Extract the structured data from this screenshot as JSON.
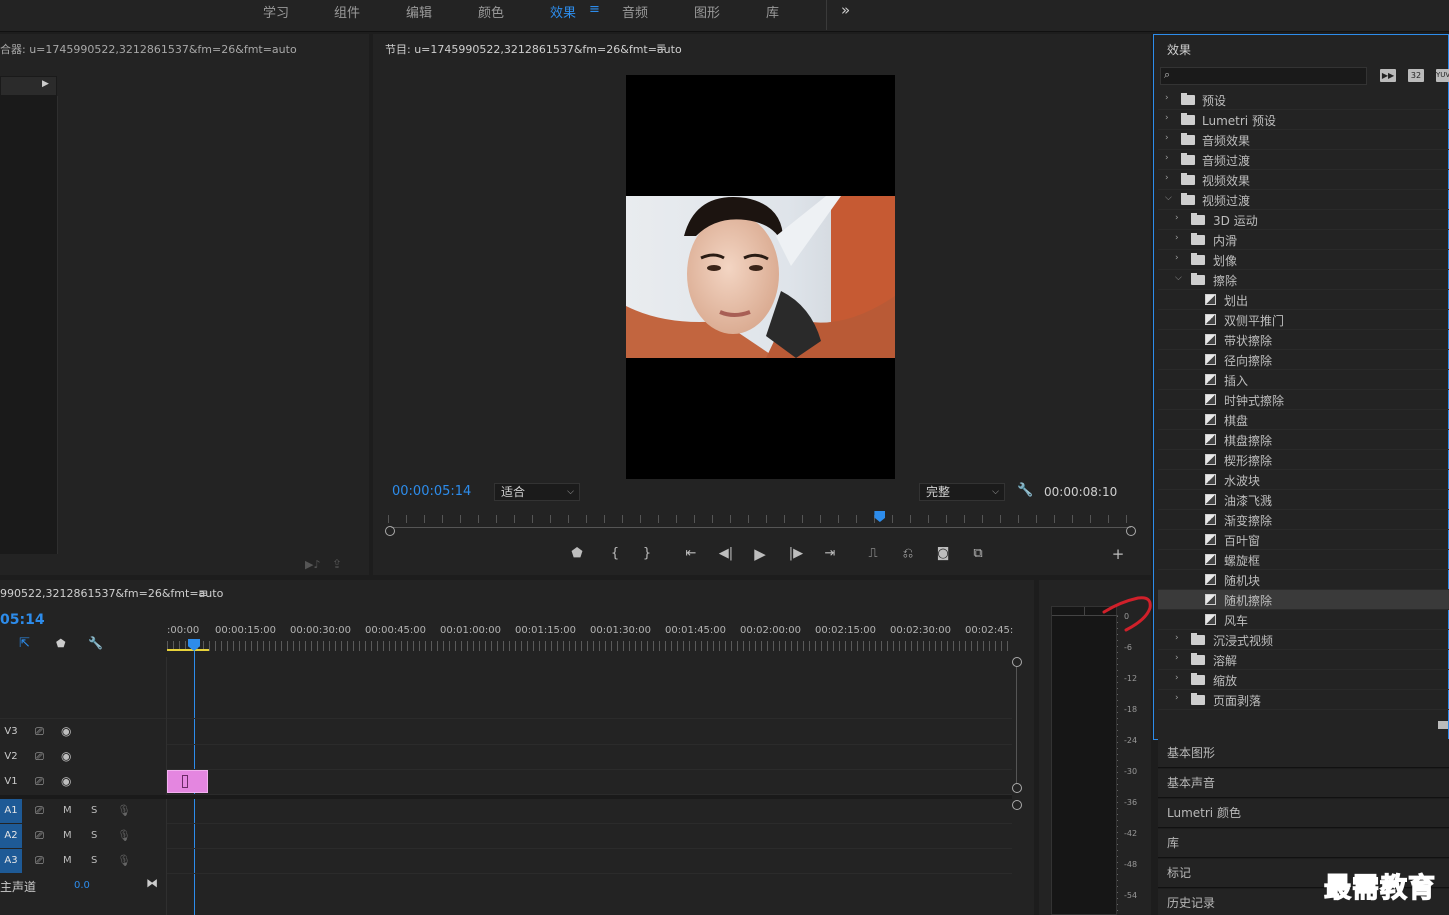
{
  "workspace_tabs": [
    {
      "label": "学习",
      "active": false
    },
    {
      "label": "组件",
      "active": false
    },
    {
      "label": "编辑",
      "active": false
    },
    {
      "label": "颜色",
      "active": false
    },
    {
      "label": "效果",
      "active": true
    },
    {
      "label": "音频",
      "active": false
    },
    {
      "label": "图形",
      "active": false
    },
    {
      "label": "库",
      "active": false
    }
  ],
  "workspace_menu_icon": "≡",
  "overflow_icon": "»",
  "source_panel": {
    "title": "合器: u=1745990522,3212861537&fm=26&fmt=auto"
  },
  "program_monitor": {
    "title": "节目: u=1745990522,3212861537&fm=26&fmt=auto",
    "current_timecode": "00:00:05:14",
    "zoom_select": "适合",
    "quality_select": "完整",
    "duration": "00:00:08:10",
    "playhead_fraction": 0.66
  },
  "timeline": {
    "title": "990522,3212861537&fm=26&fmt=auto",
    "timecode_partial": "05:14",
    "ruler_labels": [
      ":00:00",
      "00:00:15:00",
      "00:00:30:00",
      "00:00:45:00",
      "00:01:00:00",
      "00:01:15:00",
      "00:01:30:00",
      "00:01:45:00",
      "00:02:00:00",
      "00:02:15:00",
      "00:02:30:00",
      "00:02:45:"
    ],
    "video_tracks": [
      "V3",
      "V2",
      "V1"
    ],
    "audio_tracks": [
      "A1",
      "A2",
      "A3"
    ],
    "audio_m": "M",
    "audio_s": "S",
    "master_label": "主声道",
    "master_value": "0.0"
  },
  "audio_meter": {
    "labels": [
      "0",
      "-6",
      "-12",
      "-18",
      "-24",
      "-30",
      "-36",
      "-42",
      "-48",
      "-54"
    ]
  },
  "effects_panel": {
    "title": "效果",
    "search_placeholder": "",
    "badges": [
      "32",
      "YUV"
    ],
    "tree": [
      {
        "label": "预设",
        "level": 0,
        "kind": "preset-folder",
        "expanded": false
      },
      {
        "label": "Lumetri 预设",
        "level": 0,
        "kind": "preset-folder",
        "expanded": false
      },
      {
        "label": "音频效果",
        "level": 0,
        "kind": "folder",
        "expanded": false
      },
      {
        "label": "音频过渡",
        "level": 0,
        "kind": "folder",
        "expanded": false
      },
      {
        "label": "视频效果",
        "level": 0,
        "kind": "folder",
        "expanded": false
      },
      {
        "label": "视频过渡",
        "level": 0,
        "kind": "folder",
        "expanded": true
      },
      {
        "label": "3D 运动",
        "level": 1,
        "kind": "folder",
        "expanded": false
      },
      {
        "label": "内滑",
        "level": 1,
        "kind": "folder",
        "expanded": false
      },
      {
        "label": "划像",
        "level": 1,
        "kind": "folder",
        "expanded": false
      },
      {
        "label": "擦除",
        "level": 1,
        "kind": "folder",
        "expanded": true
      },
      {
        "label": "划出",
        "level": 2,
        "kind": "effect"
      },
      {
        "label": "双侧平推门",
        "level": 2,
        "kind": "effect"
      },
      {
        "label": "带状擦除",
        "level": 2,
        "kind": "effect"
      },
      {
        "label": "径向擦除",
        "level": 2,
        "kind": "effect"
      },
      {
        "label": "插入",
        "level": 2,
        "kind": "effect"
      },
      {
        "label": "时钟式擦除",
        "level": 2,
        "kind": "effect"
      },
      {
        "label": "棋盘",
        "level": 2,
        "kind": "effect"
      },
      {
        "label": "棋盘擦除",
        "level": 2,
        "kind": "effect"
      },
      {
        "label": "楔形擦除",
        "level": 2,
        "kind": "effect"
      },
      {
        "label": "水波块",
        "level": 2,
        "kind": "effect"
      },
      {
        "label": "油漆飞溅",
        "level": 2,
        "kind": "effect"
      },
      {
        "label": "渐变擦除",
        "level": 2,
        "kind": "effect"
      },
      {
        "label": "百叶窗",
        "level": 2,
        "kind": "effect"
      },
      {
        "label": "螺旋框",
        "level": 2,
        "kind": "effect"
      },
      {
        "label": "随机块",
        "level": 2,
        "kind": "effect"
      },
      {
        "label": "随机擦除",
        "level": 2,
        "kind": "effect",
        "selected": true
      },
      {
        "label": "风车",
        "level": 2,
        "kind": "effect"
      },
      {
        "label": "沉浸式视频",
        "level": 1,
        "kind": "folder",
        "expanded": false
      },
      {
        "label": "溶解",
        "level": 1,
        "kind": "folder",
        "expanded": false
      },
      {
        "label": "缩放",
        "level": 1,
        "kind": "folder",
        "expanded": false
      },
      {
        "label": "页面剥落",
        "level": 1,
        "kind": "folder",
        "expanded": false
      }
    ]
  },
  "collapsed_panels": [
    "基本图形",
    "基本声音",
    "Lumetri 颜色",
    "库",
    "标记",
    "历史记录"
  ],
  "watermark": "最需教育",
  "colors": {
    "accent": "#2d8ceb",
    "clip": "#e486e0",
    "selected_row": "#3a3a3a",
    "annotation": "#d0202a"
  }
}
